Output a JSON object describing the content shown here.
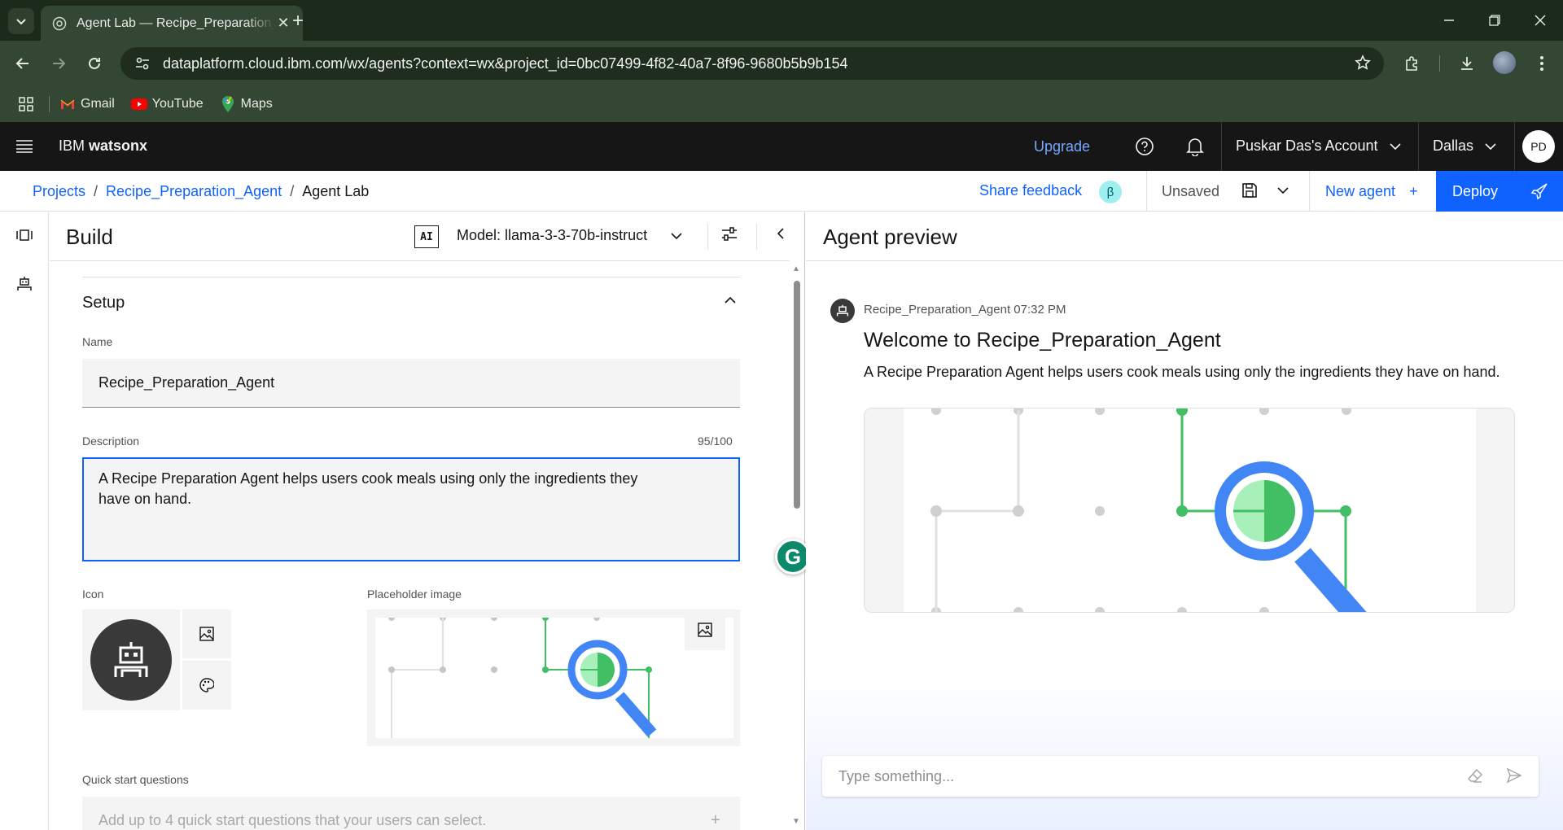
{
  "browser": {
    "tab_title": "Agent Lab — Recipe_Preparation_Agent",
    "url": "dataplatform.cloud.ibm.com/wx/agents?context=wx&project_id=0bc07499-4f82-40a7-8f96-9680b5b9b154",
    "bookmarks": [
      "Gmail",
      "YouTube",
      "Maps"
    ]
  },
  "header": {
    "brand_prefix": "IBM ",
    "brand_name": "watsonx",
    "upgrade": "Upgrade",
    "account": "Puskar Das's Account",
    "region": "Dallas",
    "avatar_initials": "PD"
  },
  "breadcrumb": {
    "items": [
      "Projects",
      "Recipe_Preparation_Agent",
      "Agent Lab"
    ],
    "separator": "/"
  },
  "actions": {
    "share_feedback": "Share feedback",
    "beta": "β",
    "unsaved": "Unsaved",
    "new_agent": "New agent",
    "new_agent_plus": "+",
    "deploy": "Deploy"
  },
  "build": {
    "title": "Build",
    "ai_badge": "AI",
    "model": "Model: llama-3-3-70b-instruct",
    "section": "Setup",
    "name_label": "Name",
    "name_value": "Recipe_Preparation_Agent",
    "description_label": "Description",
    "description_counter": "95/100",
    "description_value": "A Recipe Preparation Agent helps users cook meals using only the ingredients they have on hand.",
    "icon_label": "Icon",
    "placeholder_label": "Placeholder image",
    "quick_start_label": "Quick start questions",
    "quick_start_placeholder": "Add up to 4 quick start questions that your users can select.",
    "quick_start_plus": "+"
  },
  "preview": {
    "title": "Agent preview",
    "meta": "Recipe_Preparation_Agent 07:32 PM",
    "welcome": "Welcome to Recipe_Preparation_Agent",
    "description": "A Recipe Preparation Agent helps users cook meals using only the ingredients they have on hand.",
    "input_placeholder": "Type something..."
  },
  "colors": {
    "ibm_blue": "#0f62fe",
    "green": "#42be65",
    "magnifier_blue": "#4285f4",
    "chrome_dark": "#1b2a1b",
    "chrome_mid": "#344634"
  },
  "grammarly": "G"
}
